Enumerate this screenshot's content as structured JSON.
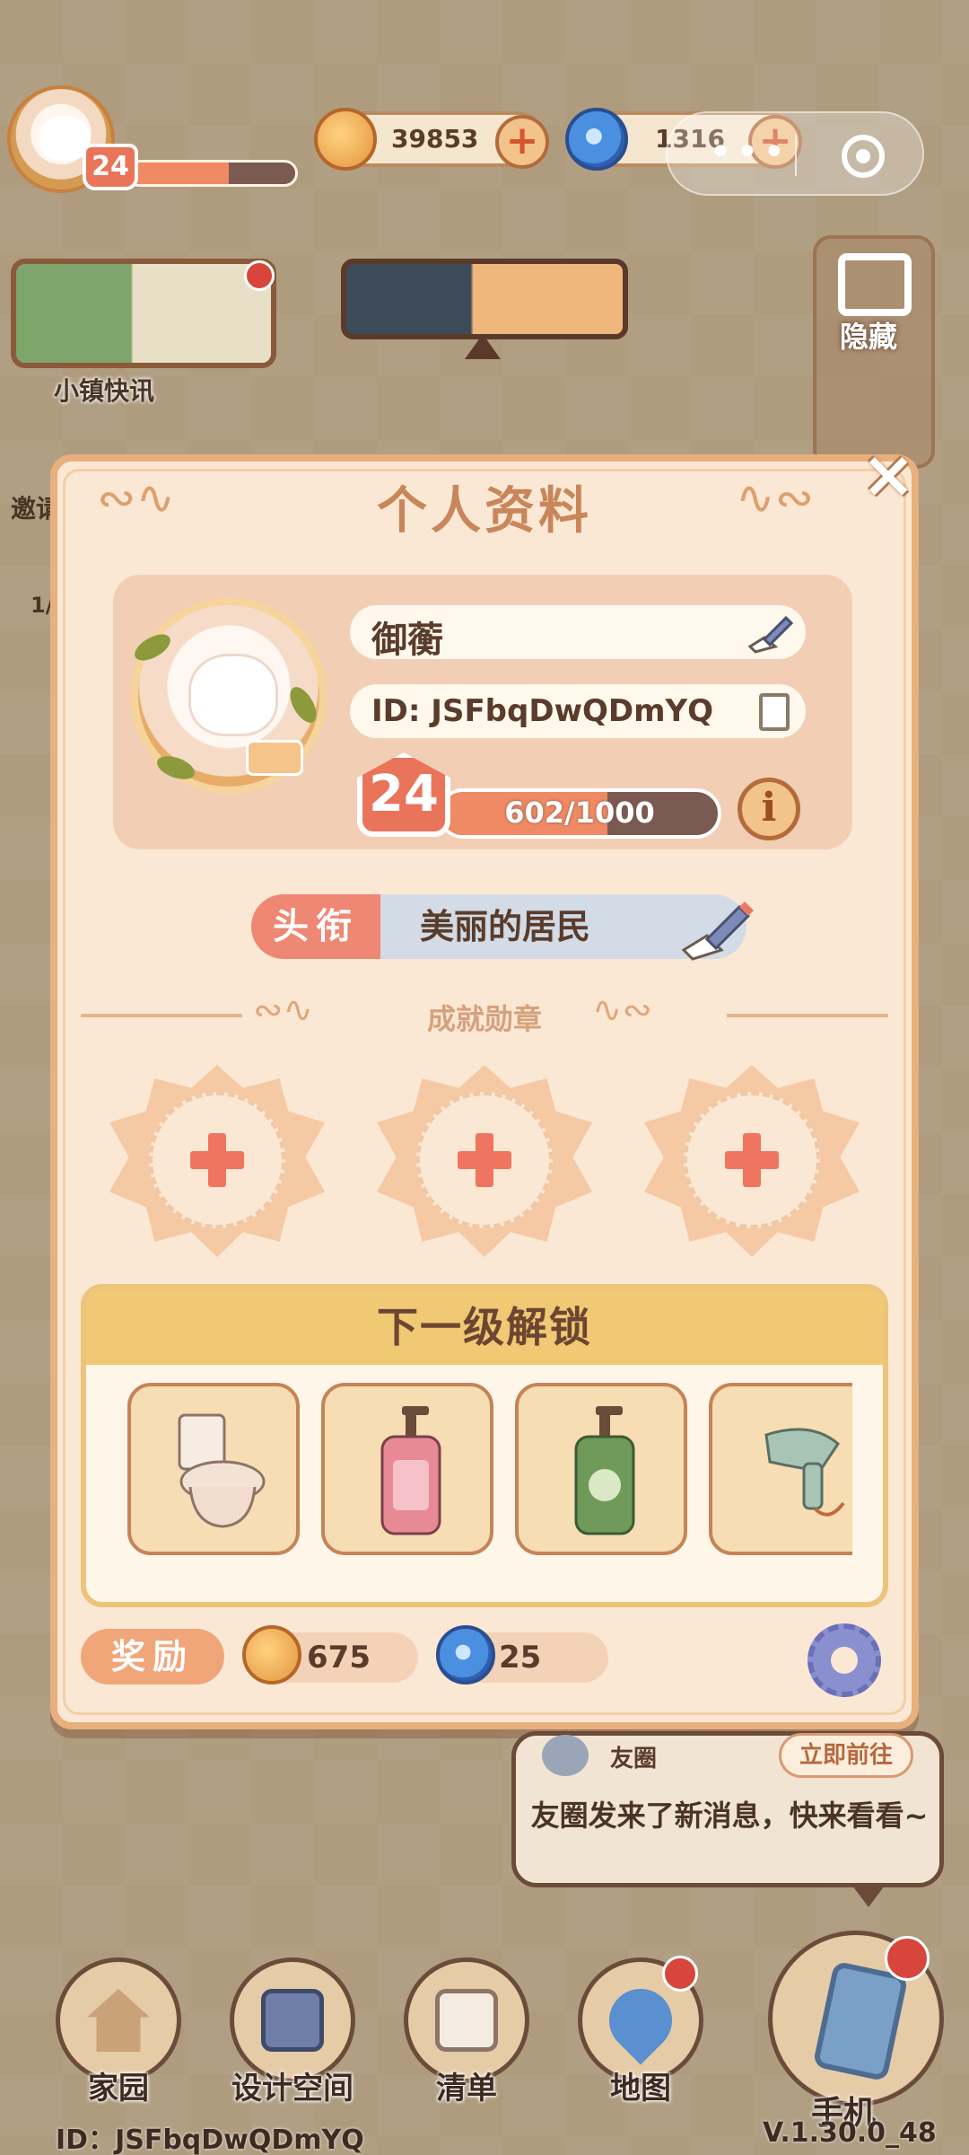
{
  "hud": {
    "level": "24",
    "level_progress": 0.6,
    "coins": "39853",
    "gems": "1316"
  },
  "news": {
    "label": "小镇快讯"
  },
  "side": {
    "hide_label": "隐藏"
  },
  "left_stubs": {
    "invite": "邀请",
    "slash": "1/"
  },
  "profile": {
    "title": "个人资料",
    "name": "御蘅",
    "id_text": "ID: JSFbqDwQDmYQ",
    "level": "24",
    "xp_text": "602/1000",
    "xp_ratio": 0.602,
    "title_tag": "头衔",
    "title_value": "美丽的居民",
    "badges_heading": "成就勋章",
    "badge_slots": 3
  },
  "unlock": {
    "heading": "下一级解锁",
    "items": [
      "toilet-icon",
      "pink-soap-dispenser-icon",
      "green-soap-dispenser-icon",
      "hair-dryer-icon"
    ]
  },
  "reward": {
    "label": "奖励",
    "coins": "675",
    "gems": "25"
  },
  "notification": {
    "title": "友圈",
    "button": "立即前往",
    "body": "友圈发来了新消息，快来看看~"
  },
  "nav": {
    "home": "家园",
    "design": "设计空间",
    "list": "清单",
    "map": "地图",
    "phone": "手机"
  },
  "footer": {
    "id": "ID：JSFbqDwQDmYQ",
    "version": "V.1.30.0_48"
  },
  "colors": {
    "accent": "#ef8a64",
    "dialog_bg": "#fbe8d4",
    "badge": "#ef7560",
    "alert": "#d8453b"
  }
}
